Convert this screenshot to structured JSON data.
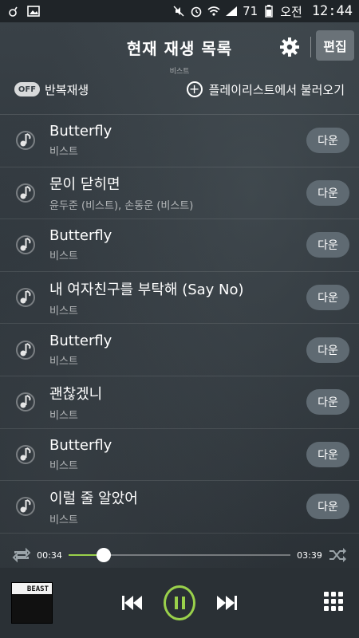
{
  "status_bar": {
    "clock": "12:44",
    "am_pm": "오전",
    "battery": "71",
    "icons": [
      "notification-icon",
      "image-icon",
      "mute-icon",
      "alarm-icon",
      "wifi-icon",
      "signal-icon",
      "battery-icon"
    ]
  },
  "header": {
    "title": "현재 재생 목록",
    "now_playing_artist": "비스트",
    "settings_icon": "gear-icon",
    "edit_label": "편집"
  },
  "toolbar": {
    "repeat_toggle": "OFF",
    "repeat_label": "반복재생",
    "load_label": "플레이리스트에서 불러오기"
  },
  "songs": [
    {
      "title": "Butterfly",
      "artist": "비스트",
      "action": "다운"
    },
    {
      "title": "문이 닫히면",
      "artist": "윤두준 (비스트), 손동운 (비스트)",
      "action": "다운"
    },
    {
      "title": "Butterfly",
      "artist": "비스트",
      "action": "다운"
    },
    {
      "title": "내 여자친구를 부탁해 (Say No)",
      "artist": "비스트",
      "action": "다운"
    },
    {
      "title": "Butterfly",
      "artist": "비스트",
      "action": "다운"
    },
    {
      "title": "괜찮겠니",
      "artist": "비스트",
      "action": "다운"
    },
    {
      "title": "Butterfly",
      "artist": "비스트",
      "action": "다운"
    },
    {
      "title": "이럴 줄 알았어",
      "artist": "비스트",
      "action": "다운"
    }
  ],
  "progress": {
    "elapsed": "00:34",
    "total": "03:39",
    "fraction": 0.16
  },
  "player": {
    "album_text": "BEAST",
    "accent_color": "#9ad14b"
  }
}
